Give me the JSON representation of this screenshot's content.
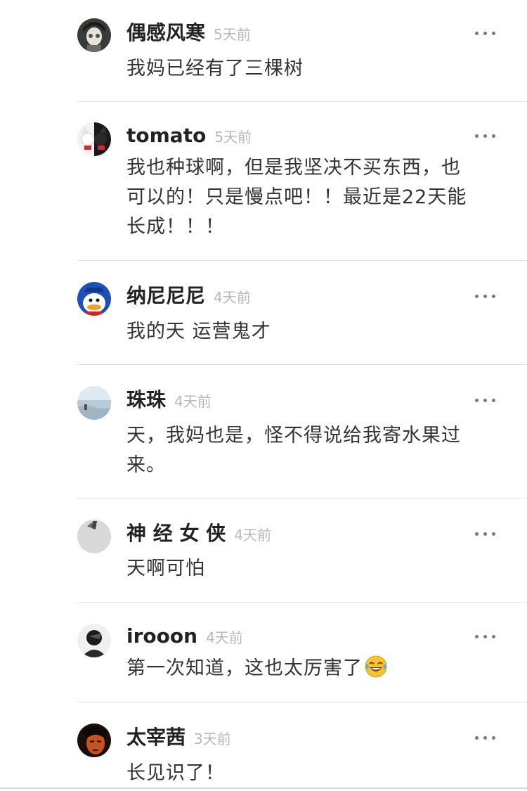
{
  "comments": [
    {
      "user": "偶感风寒",
      "time": "5天前",
      "text": [
        "我妈已经有了三棵树"
      ]
    },
    {
      "user": "tomato",
      "time": "5天前",
      "text": [
        "我也种球啊，但是我坚决不买东西，也",
        "可以的！只是慢点吧！！最近是22天能",
        "长成！！！"
      ]
    },
    {
      "user": "纳尼尼尼",
      "time": "4天前",
      "text": [
        "我的天 运营鬼才"
      ]
    },
    {
      "user": "珠珠",
      "time": "4天前",
      "text": [
        "天，我妈也是，怪不得说给我寄水果过",
        "来。"
      ]
    },
    {
      "user": "神 经 女 侠",
      "time": "4天前",
      "text": [
        "天啊可怕"
      ]
    },
    {
      "user": "irooon",
      "time": "4天前",
      "text": [
        "第一次知道，这也太厉害了"
      ],
      "emoji": "tears-of-joy-emoji"
    },
    {
      "user": "太宰茜",
      "time": "3天前",
      "text": [
        "长见识了！"
      ]
    }
  ]
}
